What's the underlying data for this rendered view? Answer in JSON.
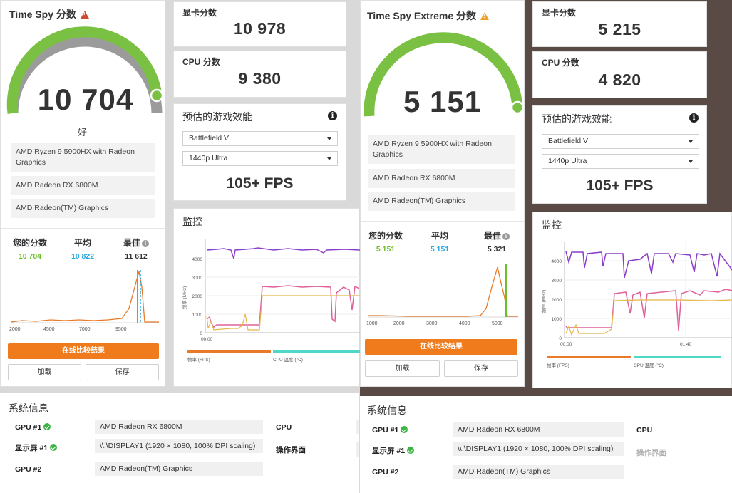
{
  "left": {
    "main_title": "Time Spy 分数",
    "score": "10 704",
    "rating": "好",
    "hardware": [
      "AMD Ryzen 9 5900HX with Radeon Graphics",
      "AMD Radeon RX 6800M",
      "AMD Radeon(TM) Graphics"
    ],
    "compare": {
      "yours_label": "您的分数",
      "yours_value": "10 704",
      "avg_label": "平均",
      "avg_value": "10 822",
      "best_label": "最佳",
      "best_value": "11 612"
    },
    "dist_ticks": [
      "2000",
      "4500",
      "7000",
      "9500"
    ],
    "compare_button": "在线比较结果",
    "load_button": "加载",
    "save_button": "保存",
    "gpu_score_label": "显卡分数",
    "gpu_score": "10 978",
    "cpu_score_label": "CPU 分数",
    "cpu_score": "9 380",
    "perf_title": "预估的游戏效能",
    "game_select": "Battlefield V",
    "preset_select": "1440p Ultra",
    "fps": "105+ FPS",
    "monitor_title": "监控",
    "monitor_y_label": "频率 (MHz)",
    "monitor_y_ticks": [
      "0",
      "1000",
      "2000",
      "3000",
      "4000"
    ],
    "monitor_x_ticks": [
      "00:00"
    ],
    "legend": [
      "帧率 (FPS)",
      "CPU 温度 (°C)"
    ],
    "sys_title": "系统信息",
    "sys_rows": [
      {
        "label": "GPU #1",
        "value": "AMD Radeon RX 6800M"
      },
      {
        "label": "显示屏 #1",
        "value": "\\\\.\\DISPLAY1 (1920 × 1080, 100% DPI scaling)"
      },
      {
        "label": "GPU #2",
        "value": "AMD Radeon(TM) Graphics"
      }
    ],
    "sys_keys": [
      "CPU",
      "操作界面"
    ]
  },
  "right": {
    "main_title": "Time Spy Extreme 分数",
    "score": "5 151",
    "hardware": [
      "AMD Ryzen 9 5900HX with Radeon Graphics",
      "AMD Radeon RX 6800M",
      "AMD Radeon(TM) Graphics"
    ],
    "compare": {
      "yours_label": "您的分数",
      "yours_value": "5 151",
      "avg_label": "平均",
      "avg_value": "5 151",
      "best_label": "最佳",
      "best_value": "5 321"
    },
    "dist_ticks": [
      "1000",
      "2000",
      "3000",
      "4000",
      "5000"
    ],
    "compare_button": "在线比较结果",
    "load_button": "加载",
    "save_button": "保存",
    "gpu_score_label": "显卡分数",
    "gpu_score": "5 215",
    "cpu_score_label": "CPU 分数",
    "cpu_score": "4 820",
    "perf_title": "预估的游戏效能",
    "game_select": "Battlefield V",
    "preset_select": "1440p Ultra",
    "fps": "105+ FPS",
    "monitor_title": "监控",
    "monitor_y_label": "频率 (MHz)",
    "monitor_y_ticks": [
      "0",
      "1000",
      "2000",
      "3000",
      "4000"
    ],
    "monitor_x_ticks": [
      "00:00",
      "01:40"
    ],
    "legend": [
      "帧率 (FPS)",
      "CPU 温度 (°C)"
    ],
    "sys_title": "系统信息",
    "sys_rows": [
      {
        "label": "GPU #1",
        "value": "AMD Radeon RX 6800M"
      },
      {
        "label": "显示屏 #1",
        "value": "\\\\.\\DISPLAY1 (1920 × 1080, 100% DPI scaling)"
      },
      {
        "label": "GPU #2",
        "value": "AMD Radeon(TM) Graphics"
      }
    ],
    "sys_keys": [
      "CPU",
      "操作界面"
    ]
  },
  "colors": {
    "gauge_green": "#7ac143",
    "gauge_gray": "#9b9b9b",
    "your_score": "#6cbf2a",
    "avg_score": "#29a8e0",
    "orange": "#f07b1d",
    "cpu_clock": "#8b3ec9",
    "gpu_clock": "#e0609c",
    "gpu_temp": "#e8b84a",
    "fps_legend": "#e87a28",
    "cpu_temp_legend": "#4fd8c8"
  }
}
